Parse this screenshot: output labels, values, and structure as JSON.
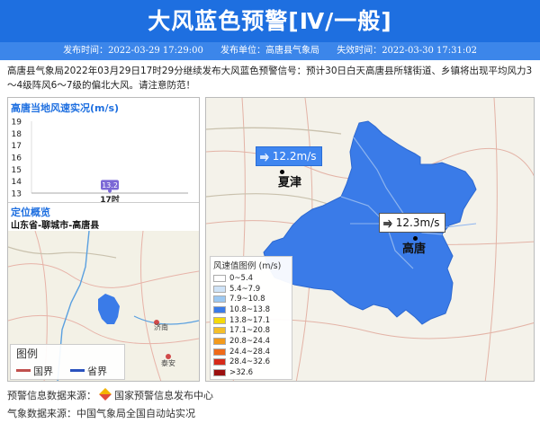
{
  "header": {
    "title": "大风蓝色预警[Ⅳ/一般]",
    "publish_time_label": "发布时间：",
    "publish_time": "2022-03-29 17:29:00",
    "publisher_label": "发布单位：",
    "publisher": "高唐县气象局",
    "expire_label": "失效时间：",
    "expire_time": "2022-03-30 17:31:02"
  },
  "description": "高唐县气象局2022年03月29日17时29分继续发布大风蓝色预警信号：预计30日白天高唐县所辖街道、乡镇将出现平均风力3～4级阵风6～7级的偏北大风。请注意防范！",
  "wind_panel": {
    "title": "高唐当地风速实况(m/s)",
    "chart_data": {
      "type": "bar",
      "categories": [
        "17时"
      ],
      "values": [
        13.2
      ],
      "title": "高唐当地风速实况(m/s)",
      "ylabel": "",
      "xlabel": "",
      "ylim": [
        13,
        19
      ],
      "yticks": [
        13,
        14,
        15,
        16,
        17,
        18,
        19
      ],
      "color": "#7b68d6"
    }
  },
  "location_panel": {
    "title": "定位概览",
    "path": "山东省-聊城市-高唐县",
    "legend_title": "图例",
    "legend_items": [
      {
        "label": "国界",
        "color": "#c0504d"
      },
      {
        "label": "省界",
        "color": "#2a52be"
      }
    ],
    "map_labels": [
      "济南",
      "泰安"
    ]
  },
  "map": {
    "tags": [
      {
        "label": "12.2m/s",
        "style": "blue"
      },
      {
        "label": "12.3m/s",
        "style": "white"
      }
    ],
    "cities": [
      "夏津",
      "高唐"
    ],
    "fill_color": "#3a7be8",
    "scale_title": "风速值图例 (m/s)",
    "scale": [
      {
        "label": "0~5.4",
        "color": "#ffffff"
      },
      {
        "label": "5.4~7.9",
        "color": "#cfe3f7"
      },
      {
        "label": "7.9~10.8",
        "color": "#9cc8f2"
      },
      {
        "label": "10.8~13.8",
        "color": "#3a7be8"
      },
      {
        "label": "13.8~17.1",
        "color": "#f5d90a"
      },
      {
        "label": "17.1~20.8",
        "color": "#f4bf2a"
      },
      {
        "label": "20.8~24.4",
        "color": "#f39a1c"
      },
      {
        "label": "24.4~28.4",
        "color": "#ef6a1a"
      },
      {
        "label": "28.4~32.6",
        "color": "#d62a1a"
      },
      {
        "label": ">32.6",
        "color": "#9b1010"
      }
    ]
  },
  "footer": {
    "warning_source_label": "预警信息数据来源：",
    "warning_source": "国家预警信息发布中心",
    "weather_source_label": "气象数据来源：",
    "weather_source": "中国气象局全国自动站实况"
  }
}
